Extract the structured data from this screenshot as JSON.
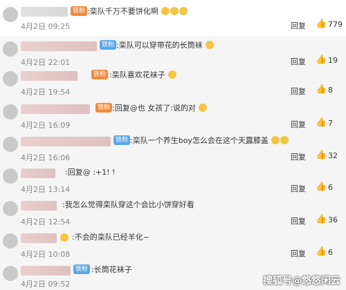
{
  "rows": [
    {
      "badge": "铁粉",
      "comment": ":栾队千万不要饼化啊",
      "emoji_count": 3,
      "date": "4月2日 09:25",
      "reply": "回复",
      "likes": "779"
    },
    {
      "badge": "铁粉",
      "comment": ":栾队可以穿带花的长筒袜",
      "emoji_count": 1,
      "date": "4月2日 22:01",
      "reply": "回复",
      "likes": "19"
    },
    {
      "badge": "铁粉",
      "comment": ":栾队喜欢花袜子",
      "emoji_count": 1,
      "date": "4月2日 19:54",
      "reply": "回复",
      "likes": "8"
    },
    {
      "badge": "铁粉",
      "comment": ":回复@也 女孩了:说的对",
      "emoji_count": 1,
      "date": "4月2日 16:09",
      "reply": "回复",
      "likes": "7"
    },
    {
      "badge": "铁粉",
      "comment": ":栾队一个养生boy怎么会在这个天露膝盖",
      "emoji_count": 2,
      "date": "4月2日 16:06",
      "reply": "回复",
      "likes": "32"
    },
    {
      "badge": "",
      "comment": ":回复@ :+1! !",
      "emoji_count": 0,
      "date": "4月2日 13:14",
      "reply": "回复",
      "likes": "6"
    },
    {
      "badge": "",
      "comment": ":我怎么觉得栾队穿这个会比小饼穿好看",
      "emoji_count": 0,
      "date": "4月2日 12:54",
      "reply": "回复",
      "likes": "36"
    },
    {
      "badge": "",
      "comment": ":不会的栾队已经羊化~",
      "emoji_count": 0,
      "date": "4月2日 10:08",
      "reply": "回复",
      "likes": "6"
    },
    {
      "badge": "铁粉",
      "comment": ":长筒花袜子",
      "emoji_count": 0,
      "date": "4月2日 09:52",
      "reply": "回复",
      "likes": ""
    }
  ],
  "watermark": "搜狐号@悠悠闲云",
  "colors": {
    "badge_orange": "#f08a3c",
    "badge_blue": "#5aa7e6",
    "row_bg": "#f5f5f5"
  }
}
